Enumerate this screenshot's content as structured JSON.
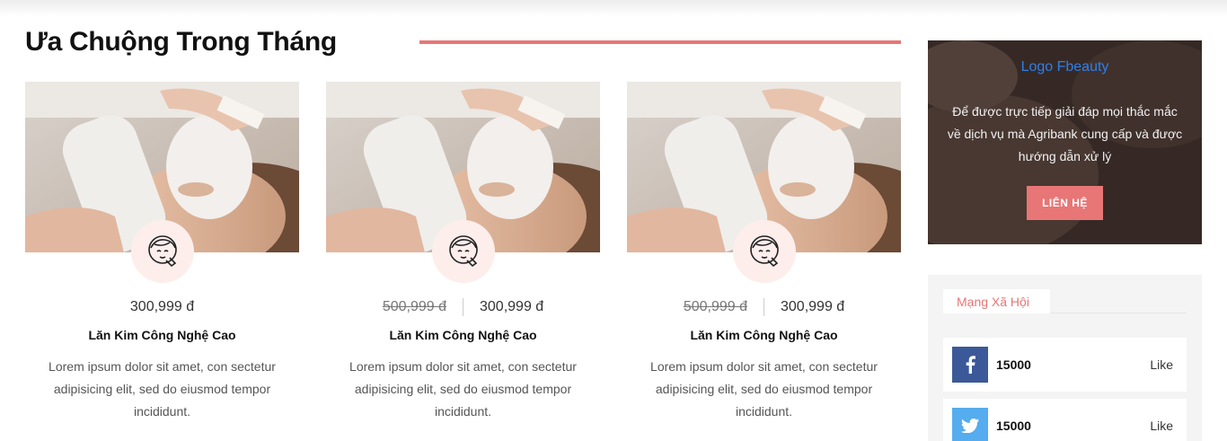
{
  "section": {
    "title": "Ưa Chuộng Trong Tháng"
  },
  "products": [
    {
      "old_price": "",
      "price": "300,999 đ",
      "name": "Lăn Kim Công Nghệ Cao",
      "description": "Lorem ipsum dolor sit amet, con sectetur adipisicing elit, sed do eiusmod tempor incididunt."
    },
    {
      "old_price": "500,999 đ",
      "price": "300,999 đ",
      "name": "Lăn Kim Công Nghệ Cao",
      "description": "Lorem ipsum dolor sit amet, con sectetur adipisicing elit, sed do eiusmod tempor incididunt."
    },
    {
      "old_price": "500,999 đ",
      "price": "300,999 đ",
      "name": "Lăn Kim Công Nghệ Cao",
      "description": "Lorem ipsum dolor sit amet, con sectetur adipisicing elit, sed do eiusmod tempor incididunt."
    }
  ],
  "promo": {
    "logo_text": "Logo Fbeauty",
    "text": "Để được trực tiếp giải đáp mọi thắc mắc về dịch vụ mà Agribank cung cấp và được hướng dẫn xử lý",
    "button_label": "LIÊN HỆ"
  },
  "social": {
    "tab_label": "Mạng Xã Hội",
    "rows": [
      {
        "icon": "facebook-icon",
        "count": "15000",
        "action": "Like",
        "color": "#3b5998"
      },
      {
        "icon": "twitter-icon",
        "count": "15000",
        "action": "Like",
        "color": "#55acee"
      }
    ]
  },
  "colors": {
    "accent": "#e87676",
    "logo_link": "#2f7fe8"
  }
}
